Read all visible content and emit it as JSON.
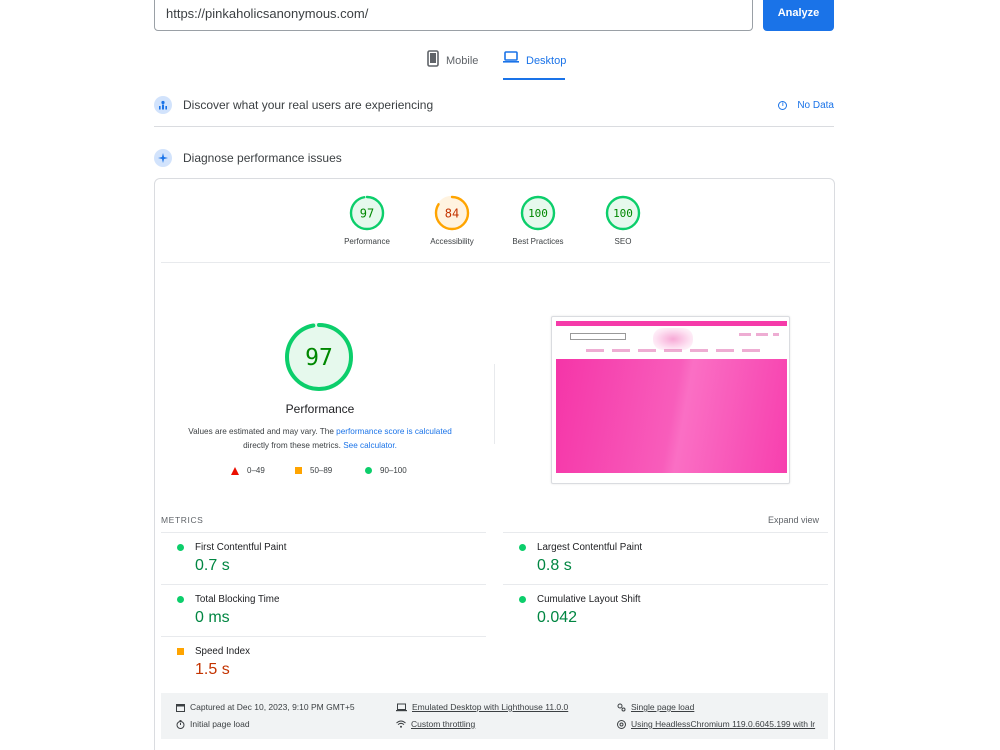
{
  "search": {
    "url_value": "https://pinkaholicsanonymous.com/",
    "analyze_label": "Analyze"
  },
  "tabs": [
    {
      "label": "Mobile",
      "icon": "phone-icon",
      "selected": false
    },
    {
      "label": "Desktop",
      "icon": "laptop-icon",
      "selected": true
    }
  ],
  "field_data": {
    "title": "Discover what your real users are experiencing",
    "status": "No Data"
  },
  "lab_data": {
    "title": "Diagnose performance issues"
  },
  "categories": [
    {
      "label": "Performance",
      "score": "97",
      "score_value": 97,
      "color": "#0cce6b",
      "text_color": "#008800"
    },
    {
      "label": "Accessibility",
      "score": "84",
      "score_value": 84,
      "color": "#ffa400",
      "text_color": "#c33300"
    },
    {
      "label": "Best Practices",
      "score": "100",
      "score_value": 100,
      "color": "#0cce6b",
      "text_color": "#008800"
    },
    {
      "label": "SEO",
      "score": "100",
      "score_value": 100,
      "color": "#0cce6b",
      "text_color": "#008800"
    }
  ],
  "main_score": {
    "score": "97",
    "score_value": 97,
    "title": "Performance",
    "disclaimer_pre": "Values are estimated and may vary. The ",
    "disclaimer_link1": "performance score is calculated",
    "disclaimer_mid": " directly from these metrics. ",
    "disclaimer_link2": "See calculator."
  },
  "legend": [
    {
      "range": "0–49",
      "shape": "triangle",
      "color": "#eb0f00"
    },
    {
      "range": "50–89",
      "shape": "square",
      "color": "#ffa400"
    },
    {
      "range": "90–100",
      "shape": "circle",
      "color": "#0cce6b"
    }
  ],
  "metrics": {
    "header": "METRICS",
    "expand_label": "Expand view",
    "items": [
      {
        "name": "First Contentful Paint",
        "value": "0.7 s",
        "rating": "pass"
      },
      {
        "name": "Largest Contentful Paint",
        "value": "0.8 s",
        "rating": "pass"
      },
      {
        "name": "Total Blocking Time",
        "value": "0 ms",
        "rating": "pass"
      },
      {
        "name": "Cumulative Layout Shift",
        "value": "0.042",
        "rating": "pass"
      },
      {
        "name": "Speed Index",
        "value": "1.5 s",
        "rating": "average"
      }
    ]
  },
  "run_info": {
    "captured": "Captured at Dec 10, 2023, 9:10 PM GMT+5",
    "device": "Emulated Desktop with Lighthouse 11.0.0",
    "session": "Single page load",
    "load": "Initial page load",
    "throttling": "Custom throttling",
    "browser": "Using HeadlessChromium 119.0.6045.199 with lr"
  },
  "colors": {
    "accent": "#1a73e8",
    "pass": "#0cce6b",
    "average": "#ffa400",
    "fail": "#eb0f00",
    "thumbnail_pink": "#f535a8"
  }
}
